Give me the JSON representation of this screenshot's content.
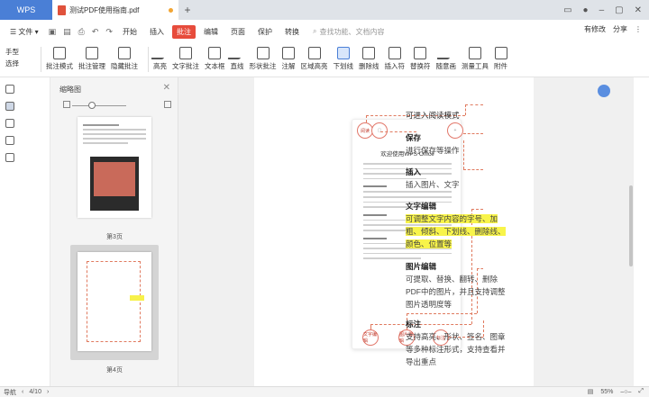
{
  "titlebar": {
    "app_tab": "WPS",
    "doc_tab": "测试PDF使用指南.pdf",
    "new_tab": "+"
  },
  "menu": {
    "file": "☰ 文件 ▾",
    "items": [
      "开始",
      "插入",
      "批注",
      "编辑",
      "页面",
      "保护",
      "转换"
    ],
    "active": "批注",
    "search": "查找功能、文档内容",
    "right": [
      "有修改",
      "分享"
    ]
  },
  "toolbar": {
    "hand": "手型",
    "select": "选择",
    "buttons": [
      "批注模式",
      "批注管理",
      "隐藏批注",
      "高亮",
      "文字批注",
      "文本框",
      "直线",
      "形状批注",
      "注解",
      "区域高亮",
      "下划线",
      "删除线",
      "插入符",
      "替换符",
      "随意画",
      "测量工具",
      "附件"
    ],
    "selected": "下划线"
  },
  "thumbs": {
    "title": "缩略图",
    "label1": "第3页",
    "label2": "第4页"
  },
  "doc": {
    "inner_title": "欢迎使用WPS Office",
    "top_circle": "阅读",
    "bottom_circles": [
      "文字编辑",
      "图片编辑",
      "标注"
    ],
    "reading_mode": "可进入阅读模式",
    "save_title": "保存",
    "save_desc": "进行保存等操作",
    "insert_title": "插入",
    "insert_desc": "插入图片、文字",
    "textedit_title": "文字编辑",
    "textedit_lines": [
      "可调整文字内容的字号、加",
      "粗、倾斜、下划线、删除线、",
      "颜色、位置等"
    ],
    "imgedit_title": "图片编辑",
    "imgedit_lines": [
      "可提取、替换、翻转、删除",
      "PDF中的图片，并且支持调整",
      "图片透明度等"
    ],
    "mark_title": "标注",
    "mark_lines": [
      "支持高亮、形状、签名、图章",
      "等多种标注形式，支持查看并",
      "导出重点"
    ]
  },
  "status": {
    "nav": "导航",
    "page": "4/10",
    "zoom": "55%"
  },
  "colors": {
    "accent": "#4a7fd6",
    "active_menu": "#e74c3c",
    "highlight": "#f8f44a",
    "dash": "#e07a5f"
  }
}
